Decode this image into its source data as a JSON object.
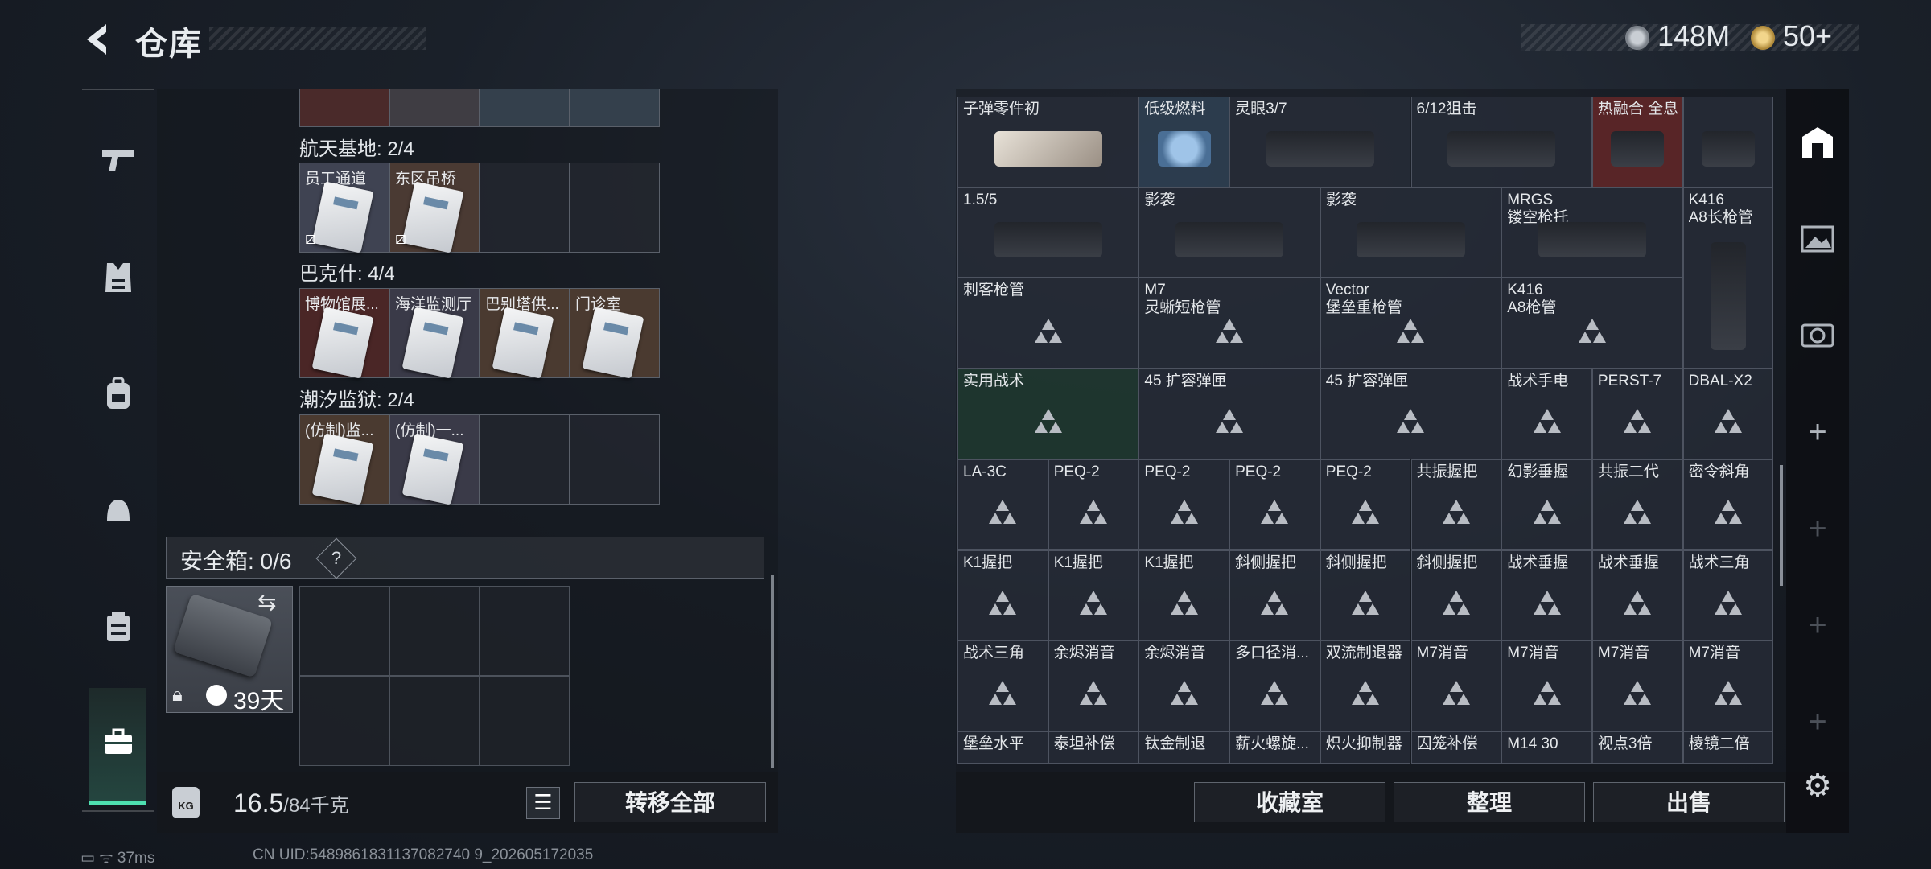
{
  "header": {
    "title": "仓库",
    "currency1": "148M",
    "currency2": "50+"
  },
  "sidebar": {
    "items": [
      "gun-icon",
      "armor-icon",
      "backpack-icon",
      "helmet-icon",
      "vest-icon",
      "briefcase-icon"
    ]
  },
  "left": {
    "groups": [
      {
        "name": "航天基地: 2/4",
        "cells": [
          "员工通道",
          "东区吊桥",
          "",
          ""
        ]
      },
      {
        "name": "巴克什: 4/4",
        "cells": [
          "博物馆展...",
          "海洋监测厅",
          "巴别塔供...",
          "门诊室"
        ]
      },
      {
        "name": "潮汐监狱: 2/4",
        "cells": [
          "(仿制)监...",
          "(仿制)一...",
          "",
          ""
        ]
      }
    ],
    "safe_title": "安全箱: 0/6",
    "safe_help": "?",
    "safe_days": "39天",
    "weight_value": "16.5",
    "weight_max": "/84千克",
    "kg_label": "KG",
    "transfer_all": "转移全部"
  },
  "right": {
    "rows": [
      [
        "子弹零件初",
        "低级燃料",
        "灵眼3/7",
        "6/12狙击",
        "热融合 全息",
        ""
      ],
      [
        "1.5/5",
        "影袭",
        "影袭",
        "MRGS\n镂空枪托",
        "K416\nA8长枪管"
      ],
      [
        "刺客枪管",
        "M7\n灵蜥短枪管",
        "Vector\n堡垒重枪管",
        "K416\nA8枪管"
      ],
      [
        "实用战术",
        "45 扩容弹匣",
        "45 扩容弹匣",
        "战术手电",
        "PERST-7",
        "DBAL-X2"
      ],
      [
        "LA-3C",
        "PEQ-2",
        "PEQ-2",
        "PEQ-2",
        "PEQ-2",
        "共振握把",
        "幻影垂握",
        "共振二代",
        "密令斜角"
      ],
      [
        "K1握把",
        "K1握把",
        "K1握把",
        "斜侧握把",
        "斜侧握把",
        "斜侧握把",
        "战术垂握",
        "战术垂握",
        "战术三角"
      ],
      [
        "战术三角",
        "余烬消音",
        "余烬消音",
        "多口径消...",
        "双流制退器",
        "M7消音",
        "M7消音",
        "M7消音",
        "M7消音"
      ],
      [
        "堡垒水平",
        "泰坦补偿",
        "钛金制退",
        "薪火螺旋...",
        "炽火抑制器",
        "囚笼补偿",
        "M14 30",
        "视点3倍",
        "棱镜二倍"
      ]
    ],
    "buttons": {
      "collection": "收藏室",
      "organize": "整理",
      "sell": "出售"
    }
  },
  "status": {
    "ping": "37ms",
    "uid": "CN UID:5489861831137082740 9_202605172035"
  },
  "colors": {
    "accent": "#4ee0b1",
    "cell_border": "#4d5360"
  }
}
